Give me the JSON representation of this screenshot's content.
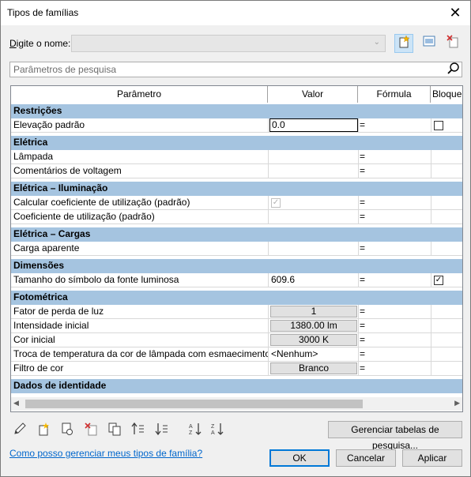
{
  "window": {
    "title": "Tipos de famílias",
    "close_glyph": "✕"
  },
  "name_field": {
    "label": "Digite o nome:",
    "value": ""
  },
  "search": {
    "placeholder": "Parâmetros de pesquisa"
  },
  "columns": [
    "Parâmetro",
    "Valor",
    "Fórmula",
    "Bloqueio"
  ],
  "categories": {
    "restricoes": "Restrições",
    "eletrica": "Elétrica",
    "eletrica_iluminacao": "Elétrica – Iluminação",
    "eletrica_cargas": "Elétrica – Cargas",
    "dimensoes": "Dimensões",
    "fotometrica": "Fotométrica",
    "dados_identidade": "Dados de identidade"
  },
  "rows": {
    "elevacao": {
      "param": "Elevação padrão",
      "value": "0.0",
      "formula": "=",
      "locked": false
    },
    "lampada": {
      "param": "Lâmpada",
      "value": "",
      "formula": "="
    },
    "comentarios_voltagem": {
      "param": "Comentários de voltagem",
      "value": "",
      "formula": "="
    },
    "calcular_coef": {
      "param": "Calcular coeficiente de utilização (padrão)",
      "checked": true,
      "formula": "="
    },
    "coef_utilizacao": {
      "param": "Coeficiente de utilização (padrão)",
      "value": "",
      "formula": "="
    },
    "carga_aparente": {
      "param": "Carga aparente",
      "value": "",
      "formula": "="
    },
    "tamanho_simbolo": {
      "param": "Tamanho do símbolo da fonte luminosa",
      "value": "609.6",
      "formula": "=",
      "locked": true
    },
    "fator_perda": {
      "param": "Fator de perda de luz",
      "value": "1",
      "formula": "="
    },
    "intensidade": {
      "param": "Intensidade inicial",
      "value": "1380.00 lm",
      "formula": "="
    },
    "cor_inicial": {
      "param": "Cor inicial",
      "value": "3000 K",
      "formula": "="
    },
    "troca_temp": {
      "param": "Troca de temperatura da cor de lâmpada com esmaecimento",
      "value": "<Nenhum>",
      "formula": "="
    },
    "filtro_cor": {
      "param": "Filtro de cor",
      "value": "Branco",
      "formula": "="
    }
  },
  "toolbar_icons": [
    "new-type-icon",
    "rename-type-icon",
    "delete-type-icon"
  ],
  "bottom_icons": [
    "pencil-icon",
    "new-parameter-icon",
    "modify-parameter-icon",
    "delete-parameter-icon",
    "copy-icon",
    "move-up-icon",
    "move-down-icon",
    "sort-ascending-icon",
    "sort-descending-icon"
  ],
  "buttons": {
    "manage_tables": "Gerenciar tabelas de pesquisa...",
    "ok": "OK",
    "cancel": "Cancelar",
    "apply": "Aplicar"
  },
  "help_link": "Como posso gerenciar meus tipos de família?"
}
